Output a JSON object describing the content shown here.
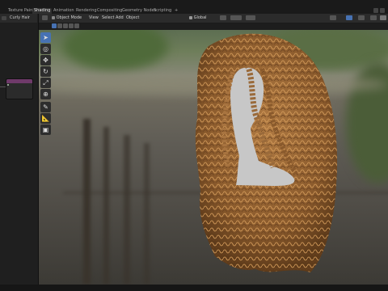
{
  "workspace_tabs": [
    "Texture Paint",
    "Shading",
    "Animation",
    "Rendering",
    "Compositing",
    "Geometry Nodes",
    "Scripting"
  ],
  "add_tab_glyph": "+",
  "active_tab": "Shading",
  "left_panel": {
    "object_name": "Curly Hair",
    "node": {
      "title": "",
      "rows": [
        "",
        "",
        ""
      ]
    }
  },
  "viewport_header": {
    "mode": "Object Mode",
    "menus": [
      "View",
      "Select",
      "Add",
      "Object"
    ],
    "transform_orientation": "Global"
  },
  "toolbar_icons": [
    "cursor-select-icon",
    "cursor-3d-icon",
    "move-icon",
    "rotate-icon",
    "scale-icon",
    "transform-icon",
    "annotate-icon",
    "measure-icon",
    "add-cube-icon"
  ],
  "colors": {
    "accent": "#4772b3",
    "hair": "#9a6a3a",
    "head": "#c7c7c7"
  }
}
